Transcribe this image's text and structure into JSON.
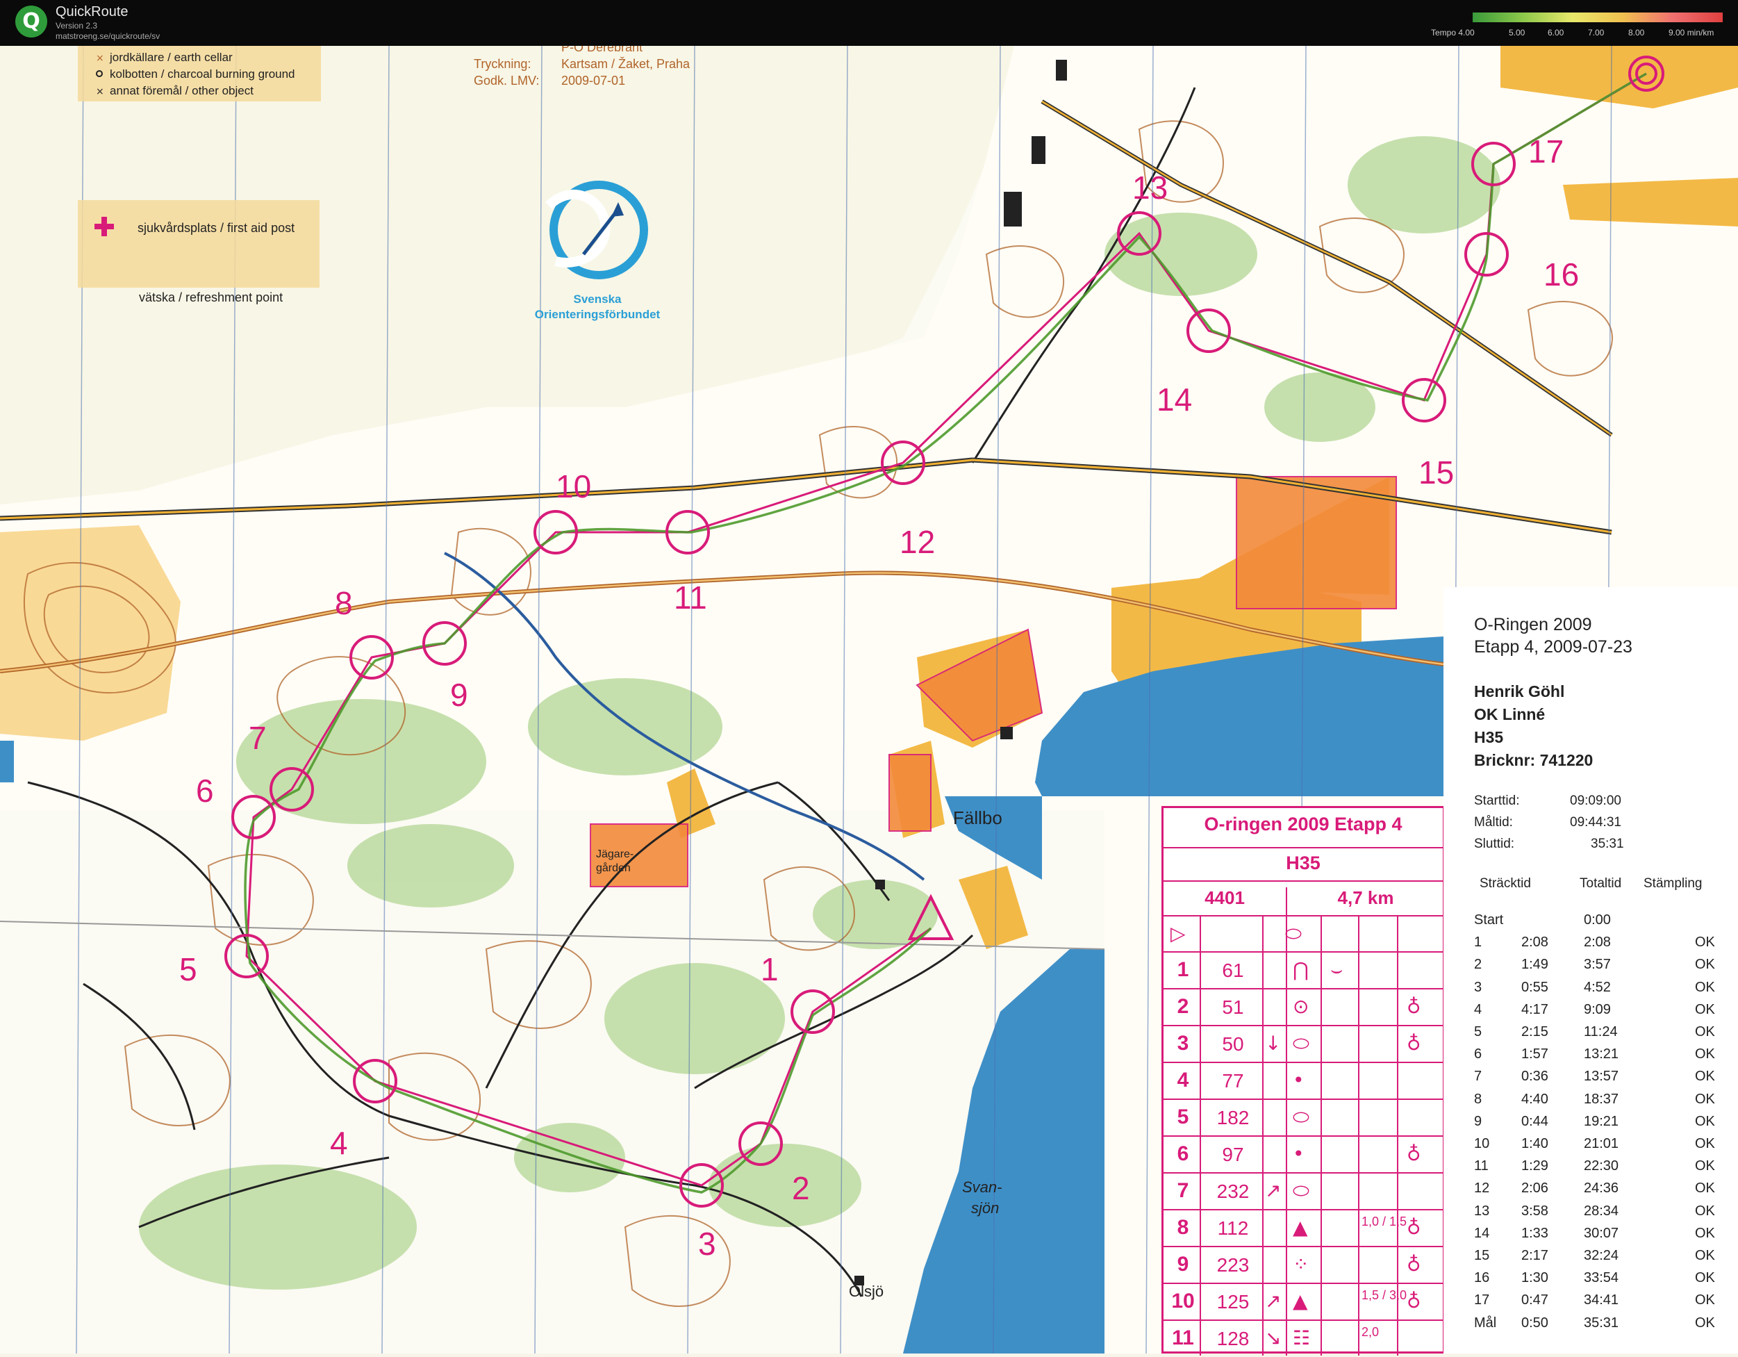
{
  "app": {
    "icon_letter": "Q",
    "name": "QuickRoute",
    "version": "Version 2.3",
    "url": "matstroeng.se/quickroute/sv"
  },
  "tempo_legend": {
    "label": "Tempo 4.00",
    "ticks": [
      "5.00",
      "6.00",
      "7.00",
      "8.00",
      "9.00 min/km"
    ]
  },
  "map_legend": {
    "items": [
      "jordkällare / earth cellar",
      "kolbotten / charcoal burning ground",
      "annat föremål / other object"
    ],
    "first_aid": "sjukvårdsplats / first aid post",
    "refreshment": "vätska / refreshment point"
  },
  "print_info": {
    "author": "P-O Derebrant",
    "printing_label": "Tryckning:",
    "printing_value": "Kartsam / Žaket, Praha",
    "approval_label": "Godk. LMV:",
    "approval_value": "2009-07-01"
  },
  "federation_logo": {
    "line1": "Svenska",
    "line2": "Orienteringsförbundet"
  },
  "place_names": {
    "fallbo": "Fällbo",
    "svansjon_1": "Svan-",
    "svansjon_2": "sjön",
    "olsjo": "Olsjö",
    "jagare_1": "Jägare-",
    "jagare_2": "gården"
  },
  "control_numbers": [
    "1",
    "2",
    "3",
    "4",
    "5",
    "6",
    "7",
    "8",
    "9",
    "10",
    "11",
    "12",
    "13",
    "14",
    "15",
    "16",
    "17"
  ],
  "result": {
    "event": "O-Ringen 2009",
    "stage": "Etapp 4, 2009-07-23",
    "runner": "Henrik Göhl",
    "club": "OK Linné",
    "class": "H35",
    "brick": "Bricknr: 741220",
    "start_label": "Starttid:",
    "start_value": "09:09:00",
    "finish_label": "Måltid:",
    "finish_value": "09:44:31",
    "total_label": "Sluttid:",
    "total_value": "35:31",
    "col_split": "Sträcktid",
    "col_total": "Totaltid",
    "col_punch": "Stämpling",
    "splits": [
      {
        "c": "Start",
        "split": "",
        "total": "0:00",
        "status": ""
      },
      {
        "c": "1",
        "split": "2:08",
        "total": "2:08",
        "status": "OK"
      },
      {
        "c": "2",
        "split": "1:49",
        "total": "3:57",
        "status": "OK"
      },
      {
        "c": "3",
        "split": "0:55",
        "total": "4:52",
        "status": "OK"
      },
      {
        "c": "4",
        "split": "4:17",
        "total": "9:09",
        "status": "OK"
      },
      {
        "c": "5",
        "split": "2:15",
        "total": "11:24",
        "status": "OK"
      },
      {
        "c": "6",
        "split": "1:57",
        "total": "13:21",
        "status": "OK"
      },
      {
        "c": "7",
        "split": "0:36",
        "total": "13:57",
        "status": "OK"
      },
      {
        "c": "8",
        "split": "4:40",
        "total": "18:37",
        "status": "OK"
      },
      {
        "c": "9",
        "split": "0:44",
        "total": "19:21",
        "status": "OK"
      },
      {
        "c": "10",
        "split": "1:40",
        "total": "21:01",
        "status": "OK"
      },
      {
        "c": "11",
        "split": "1:29",
        "total": "22:30",
        "status": "OK"
      },
      {
        "c": "12",
        "split": "2:06",
        "total": "24:36",
        "status": "OK"
      },
      {
        "c": "13",
        "split": "3:58",
        "total": "28:34",
        "status": "OK"
      },
      {
        "c": "14",
        "split": "1:33",
        "total": "30:07",
        "status": "OK"
      },
      {
        "c": "15",
        "split": "2:17",
        "total": "32:24",
        "status": "OK"
      },
      {
        "c": "16",
        "split": "1:30",
        "total": "33:54",
        "status": "OK"
      },
      {
        "c": "17",
        "split": "0:47",
        "total": "34:41",
        "status": "OK"
      },
      {
        "c": "Mål",
        "split": "0:50",
        "total": "35:31",
        "status": "OK"
      }
    ]
  },
  "control_card": {
    "title": "O-ringen 2009 Etapp 4",
    "class": "H35",
    "course": "4401",
    "length": "4,7 km",
    "rows": [
      {
        "n": "1",
        "code": "61",
        "dir": "",
        "feature": "⋂",
        "detail": "⌣",
        "where": "",
        "dim": ""
      },
      {
        "n": "2",
        "code": "51",
        "dir": "",
        "feature": "⊙",
        "detail": "",
        "where": "♁",
        "dim": ""
      },
      {
        "n": "3",
        "code": "50",
        "dir": "↓",
        "feature": "⬭",
        "detail": "",
        "where": "♁",
        "dim": ""
      },
      {
        "n": "4",
        "code": "77",
        "dir": "",
        "feature": "•",
        "detail": "",
        "where": "",
        "dim": ""
      },
      {
        "n": "5",
        "code": "182",
        "dir": "",
        "feature": "⬭",
        "detail": "",
        "where": "",
        "dim": ""
      },
      {
        "n": "6",
        "code": "97",
        "dir": "",
        "feature": "•",
        "detail": "",
        "where": "♁",
        "dim": ""
      },
      {
        "n": "7",
        "code": "232",
        "dir": "↗",
        "feature": "⬭",
        "detail": "",
        "where": "",
        "dim": ""
      },
      {
        "n": "8",
        "code": "112",
        "dir": "",
        "feature": "▲",
        "detail": "",
        "where": "♁",
        "dim": "1,0 / 1,5"
      },
      {
        "n": "9",
        "code": "223",
        "dir": "",
        "feature": "⁘",
        "detail": "",
        "where": "♁",
        "dim": ""
      },
      {
        "n": "10",
        "code": "125",
        "dir": "↗",
        "feature": "▲",
        "detail": "",
        "where": "♁",
        "dim": "1,5 / 3,0"
      },
      {
        "n": "11",
        "code": "128",
        "dir": "↘",
        "feature": "☷",
        "detail": "",
        "where": "",
        "dim": "2,0"
      }
    ]
  },
  "colors": {
    "course": "#d81b79",
    "route": "#4f9a2e",
    "water": "#3f8fc7",
    "open_land": "#f2b233",
    "contour": "#b0642a",
    "green": "#a9d08e"
  }
}
